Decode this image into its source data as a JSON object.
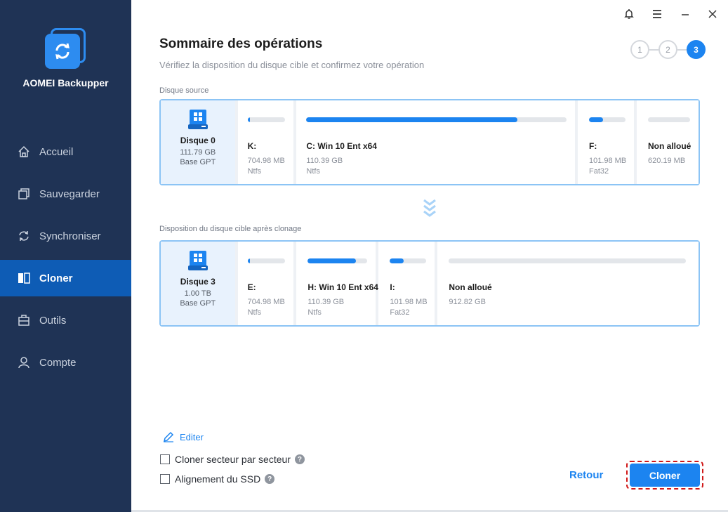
{
  "sidebar": {
    "app_name": "AOMEI Backupper",
    "items": [
      {
        "label": "Accueil",
        "icon": "home-icon"
      },
      {
        "label": "Sauvegarder",
        "icon": "backup-icon"
      },
      {
        "label": "Synchroniser",
        "icon": "sync-icon"
      },
      {
        "label": "Cloner",
        "icon": "clone-icon",
        "active": true
      },
      {
        "label": "Outils",
        "icon": "tools-icon"
      },
      {
        "label": "Compte",
        "icon": "user-icon"
      }
    ]
  },
  "titlebar": {
    "icons": [
      "bell-icon",
      "menu-icon",
      "minimize-icon",
      "close-icon"
    ]
  },
  "header": {
    "title": "Sommaire des opérations",
    "subtitle": "Vérifiez la disposition du disque cible et confirmez votre opération",
    "steps": [
      "1",
      "2",
      "3"
    ],
    "active_step": "3"
  },
  "source": {
    "label": "Disque source",
    "disk": {
      "name": "Disque 0",
      "size": "111.79 GB",
      "type": "Base GPT"
    },
    "partitions": [
      {
        "name": "K:",
        "size": "704.98 MB",
        "fs": "Ntfs",
        "fill": 0.06
      },
      {
        "name": "C: Win 10 Ent x64",
        "size": "110.39 GB",
        "fs": "Ntfs",
        "fill": 0.81
      },
      {
        "name": "F:",
        "size": "101.98 MB",
        "fs": "Fat32",
        "fill": 0.38
      },
      {
        "name": "Non alloué",
        "size": "620.19 MB",
        "fs": "",
        "fill": 0
      }
    ]
  },
  "target": {
    "label": "Disposition du disque cible après clonage",
    "disk": {
      "name": "Disque 3",
      "size": "1.00 TB",
      "type": "Base GPT"
    },
    "partitions": [
      {
        "name": "E:",
        "size": "704.98 MB",
        "fs": "Ntfs",
        "fill": 0.06
      },
      {
        "name": "H: Win 10 Ent x64",
        "size": "110.39 GB",
        "fs": "Ntfs",
        "fill": 0.81
      },
      {
        "name": "I:",
        "size": "101.98 MB",
        "fs": "Fat32",
        "fill": 0.38
      },
      {
        "name": "Non alloué",
        "size": "912.82 GB",
        "fs": "",
        "fill": 0
      }
    ]
  },
  "footer": {
    "edit_label": "Editer",
    "option_sector": "Cloner secteur par secteur",
    "option_ssd": "Alignement du SSD",
    "back_label": "Retour",
    "clone_label": "Cloner"
  },
  "colors": {
    "sidebar": "#1f3355",
    "accent": "#1c84f0",
    "active_nav": "#0e5cb5"
  }
}
